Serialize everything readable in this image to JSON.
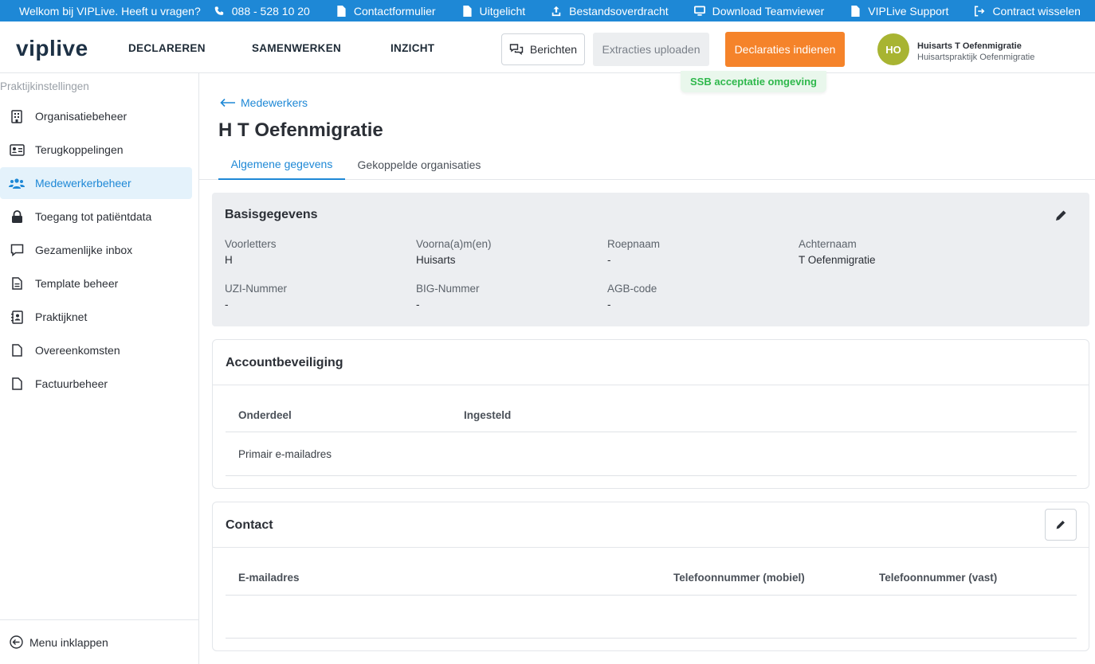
{
  "topbar": {
    "welcome": "Welkom bij VIPLive. Heeft u vragen?",
    "links": [
      {
        "label": "088 - 528 10 20",
        "icon": "phone-icon"
      },
      {
        "label": "Contactformulier",
        "icon": "document-icon"
      },
      {
        "label": "Uitgelicht",
        "icon": "document-icon"
      },
      {
        "label": "Bestandsoverdracht",
        "icon": "upload-icon"
      },
      {
        "label": "Download Teamviewer",
        "icon": "monitor-icon"
      },
      {
        "label": "VIPLive Support",
        "icon": "document-icon"
      },
      {
        "label": "Contract wisselen",
        "icon": "sign-out-icon"
      }
    ]
  },
  "header": {
    "logo": "viplive",
    "nav": [
      "DECLAREREN",
      "SAMENWERKEN",
      "INZICHT"
    ],
    "berichten": "Berichten",
    "extracties": "Extracties uploaden",
    "declaraties": "Declaraties indienen",
    "avatar_initials": "HO",
    "user_name": "Huisarts T Oefenmigratie",
    "user_practice": "Huisartspraktijk Oefenmigratie",
    "environment": "SSB acceptatie omgeving",
    "colors": {
      "topbar": "#1e88d6",
      "primary_action": "#f5832a",
      "avatar": "#a8b432",
      "environment": "#2fb84c"
    }
  },
  "sidebar": {
    "title": "Praktijkinstellingen",
    "items": [
      {
        "label": "Organisatiebeheer",
        "icon": "building-icon",
        "active": false
      },
      {
        "label": "Terugkoppelingen",
        "icon": "id-card-icon",
        "active": false
      },
      {
        "label": "Medewerkerbeheer",
        "icon": "users-icon",
        "active": true
      },
      {
        "label": "Toegang tot patiëntdata",
        "icon": "lock-icon",
        "active": false
      },
      {
        "label": "Gezamenlijke inbox",
        "icon": "chat-icon",
        "active": false
      },
      {
        "label": "Template beheer",
        "icon": "document-lines-icon",
        "active": false
      },
      {
        "label": "Praktijknet",
        "icon": "contact-book-icon",
        "active": false
      },
      {
        "label": "Overeenkomsten",
        "icon": "document-icon",
        "active": false
      },
      {
        "label": "Factuurbeheer",
        "icon": "document-icon",
        "active": false
      }
    ],
    "collapse": "Menu inklappen"
  },
  "main": {
    "back": "Medewerkers",
    "title": "H T Oefenmigratie",
    "tabs": [
      "Algemene gegevens",
      "Gekoppelde organisaties"
    ],
    "basis": {
      "title": "Basisgegevens",
      "fields": [
        {
          "label": "Voorletters",
          "value": "H"
        },
        {
          "label": "Voorna(a)m(en)",
          "value": "Huisarts"
        },
        {
          "label": "Roepnaam",
          "value": "-"
        },
        {
          "label": "Achternaam",
          "value": "T Oefenmigratie"
        },
        {
          "label": "UZI-Nummer",
          "value": "-"
        },
        {
          "label": "BIG-Nummer",
          "value": "-"
        },
        {
          "label": "AGB-code",
          "value": "-"
        }
      ]
    },
    "security": {
      "title": "Accountbeveiliging",
      "columns": [
        "Onderdeel",
        "Ingesteld"
      ],
      "rows": [
        [
          "Primair e-mailadres",
          ""
        ]
      ]
    },
    "contact": {
      "title": "Contact",
      "columns": [
        "E-mailadres",
        "Telefoonnummer (mobiel)",
        "Telefoonnummer (vast)"
      ]
    }
  }
}
